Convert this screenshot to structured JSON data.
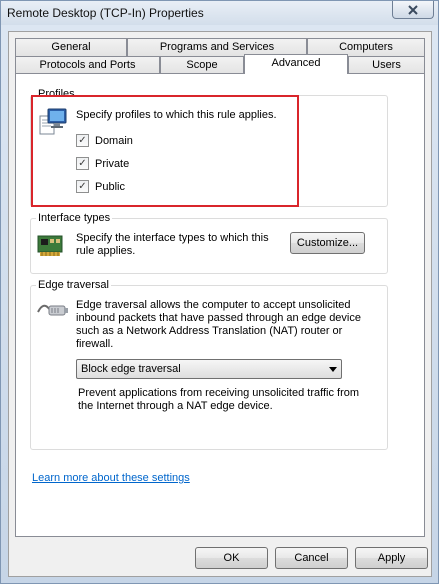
{
  "window": {
    "title": "Remote Desktop (TCP-In) Properties",
    "close_icon": "close-x-icon"
  },
  "tabs": {
    "row1": [
      {
        "label": "General"
      },
      {
        "label": "Programs and Services"
      },
      {
        "label": "Computers"
      }
    ],
    "row2": [
      {
        "label": "Protocols and Ports"
      },
      {
        "label": "Scope"
      },
      {
        "label": "Advanced",
        "active": true
      },
      {
        "label": "Users"
      }
    ]
  },
  "profiles": {
    "label": "Profiles",
    "description": "Specify profiles to which this rule applies.",
    "icon": "monitor-document-icon",
    "options": [
      {
        "label": "Domain",
        "checked": true
      },
      {
        "label": "Private",
        "checked": true
      },
      {
        "label": "Public",
        "checked": true
      }
    ],
    "check_mark": "✓"
  },
  "interface_types": {
    "label": "Interface types",
    "description": "Specify the interface types to which this rule applies.",
    "icon": "network-card-icon",
    "customize_label": "Customize..."
  },
  "edge_traversal": {
    "label": "Edge traversal",
    "description": "Edge traversal allows the computer to accept unsolicited inbound packets that have passed through an edge device such as a Network Address Translation (NAT) router or firewall.",
    "icon": "cable-connector-icon",
    "selected_option": "Block edge traversal",
    "option_description": "Prevent applications from receiving unsolicited traffic from the Internet through a NAT edge device."
  },
  "learn_more_link": "Learn more about these settings",
  "buttons": {
    "ok": "OK",
    "cancel": "Cancel",
    "apply": "Apply"
  },
  "colors": {
    "highlight": "#d9252b",
    "link": "#0066cc"
  }
}
